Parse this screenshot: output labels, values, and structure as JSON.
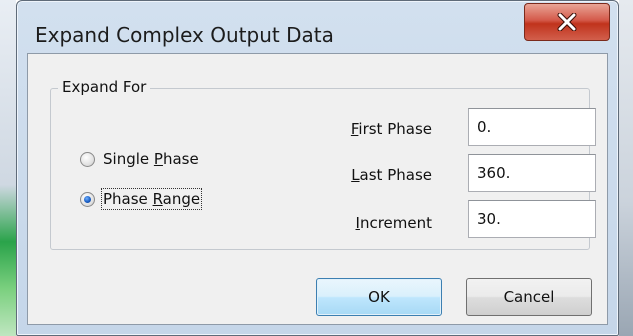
{
  "dialog": {
    "title": "Expand Complex Output Data"
  },
  "group": {
    "label": "Expand For"
  },
  "radios": {
    "single": {
      "pre": "Single ",
      "key": "P",
      "post": "hase",
      "checked": false
    },
    "range": {
      "pre": "Phase ",
      "key": "R",
      "post": "ange",
      "checked": true
    }
  },
  "fields": {
    "first": {
      "key": "F",
      "post": "irst Phase",
      "value": "0."
    },
    "last": {
      "key": "L",
      "post": "ast Phase",
      "value": "360."
    },
    "increment": {
      "key": "I",
      "post": "ncrement",
      "value": "30."
    }
  },
  "buttons": {
    "ok": "OK",
    "cancel": "Cancel"
  },
  "colors": {
    "ok_border": "#3c7fb1",
    "close_red": "#c0331c"
  }
}
